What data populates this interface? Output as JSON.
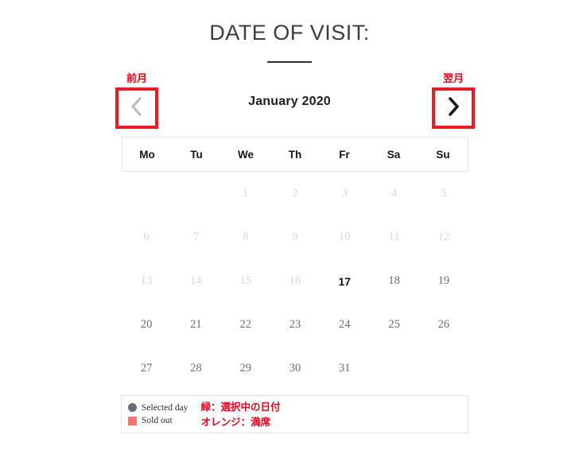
{
  "header": {
    "title": "DATE OF VISIT:"
  },
  "nav": {
    "prev": {
      "annotation": "前月",
      "icon": "chevron-left-icon",
      "state": "disabled"
    },
    "next": {
      "annotation": "翌月",
      "icon": "chevron-right-icon",
      "state": "enabled"
    },
    "month_label": "January 2020"
  },
  "calendar": {
    "weekdays": [
      "Mo",
      "Tu",
      "We",
      "Th",
      "Fr",
      "Sa",
      "Su"
    ],
    "weeks": [
      [
        {
          "label": "",
          "state": "empty"
        },
        {
          "label": "",
          "state": "empty"
        },
        {
          "label": "1",
          "state": "disabled"
        },
        {
          "label": "2",
          "state": "disabled"
        },
        {
          "label": "3",
          "state": "disabled"
        },
        {
          "label": "4",
          "state": "disabled"
        },
        {
          "label": "5",
          "state": "disabled"
        }
      ],
      [
        {
          "label": "6",
          "state": "disabled"
        },
        {
          "label": "7",
          "state": "disabled"
        },
        {
          "label": "8",
          "state": "disabled"
        },
        {
          "label": "9",
          "state": "disabled"
        },
        {
          "label": "10",
          "state": "disabled"
        },
        {
          "label": "11",
          "state": "disabled"
        },
        {
          "label": "12",
          "state": "disabled"
        }
      ],
      [
        {
          "label": "13",
          "state": "disabled"
        },
        {
          "label": "14",
          "state": "disabled"
        },
        {
          "label": "15",
          "state": "disabled"
        },
        {
          "label": "16",
          "state": "disabled"
        },
        {
          "label": "17",
          "state": "today"
        },
        {
          "label": "18",
          "state": "available"
        },
        {
          "label": "19",
          "state": "available"
        }
      ],
      [
        {
          "label": "20",
          "state": "available"
        },
        {
          "label": "21",
          "state": "available"
        },
        {
          "label": "22",
          "state": "available"
        },
        {
          "label": "23",
          "state": "available"
        },
        {
          "label": "24",
          "state": "available"
        },
        {
          "label": "25",
          "state": "available"
        },
        {
          "label": "26",
          "state": "available"
        }
      ],
      [
        {
          "label": "27",
          "state": "available"
        },
        {
          "label": "28",
          "state": "available"
        },
        {
          "label": "29",
          "state": "available"
        },
        {
          "label": "30",
          "state": "available"
        },
        {
          "label": "31",
          "state": "available"
        },
        {
          "label": "",
          "state": "empty"
        },
        {
          "label": "",
          "state": "empty"
        }
      ]
    ]
  },
  "legend": {
    "items": [
      {
        "marker": "circle-swatch",
        "label": "Selected day",
        "color": "#6b6b78"
      },
      {
        "marker": "square-swatch",
        "label": "Sold out",
        "color": "#f4766f"
      }
    ],
    "notes": [
      "緑：選択中の日付",
      "オレンジ：満席"
    ],
    "note_color": "#e3071b"
  },
  "theme": {
    "accent_red": "#ec1c24",
    "annotation_red": "#e3071b",
    "text_dark": "#3d3d45",
    "text_muted": "#6d6d75",
    "text_disabled": "#d9d9dd",
    "background": "#ffffff"
  }
}
